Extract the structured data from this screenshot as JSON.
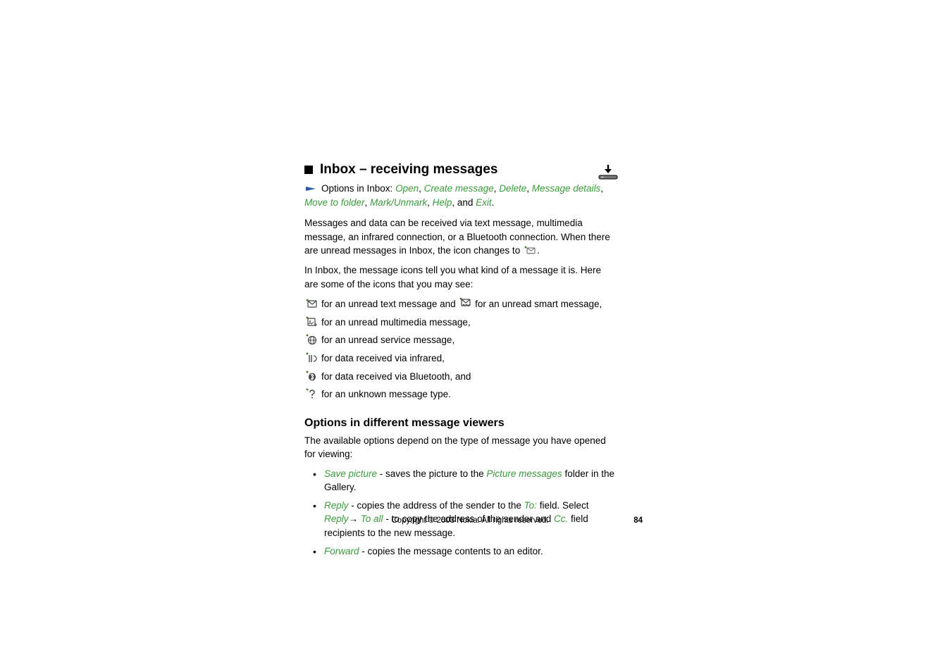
{
  "heading": "Inbox – receiving messages",
  "options_intro": "Options in Inbox: ",
  "options": {
    "open": "Open",
    "create_message": "Create message",
    "delete": "Delete",
    "message_details": "Message details",
    "move_to_folder": "Move to folder",
    "mark_unmark": "Mark/Unmark",
    "help": "Help",
    "and": ", and ",
    "exit": "Exit"
  },
  "para1_a": "Messages and data can be received via text message, multimedia message, an infrared connection, or a Bluetooth connection. When there are unread messages in Inbox, the icon changes to ",
  "para1_b": ".",
  "para2": "In Inbox, the message icons tell you what kind of a message it is. Here are some of the icons that you may see:",
  "icon_lines": {
    "text_a": " for an unread text message and ",
    "text_b": " for an unread smart message,",
    "mms": " for an unread multimedia message,",
    "service": " for an unread service message,",
    "infrared": " for data received via infrared,",
    "bluetooth": " for data received via Bluetooth, and",
    "unknown": " for an unknown message type."
  },
  "subheading": "Options in different message viewers",
  "para3": "The available options depend on the type of message you have opened for viewing:",
  "bullets": {
    "b1": {
      "save_picture": "Save picture",
      "mid1": " - saves the picture to the",
      "picture_messages": " Picture messages",
      "mid2": " folder in the Gallery."
    },
    "b2": {
      "reply": "Reply",
      "mid1": " - copies the address of the sender to the ",
      "to": "To:",
      "mid2": " field. Select ",
      "reply2": "Reply",
      "arrow": "→ ",
      "to_all": "To all",
      "mid3": " - to copy the address of the sender and ",
      "cc": "Cc.",
      "mid4": " field recipients to the new message."
    },
    "b3": {
      "forward": "Forward",
      "mid1": " - copies the message contents to an editor."
    }
  },
  "footer": {
    "copyright": "Copyright © 2003 Nokia. All rights reserved.",
    "page": "84"
  }
}
